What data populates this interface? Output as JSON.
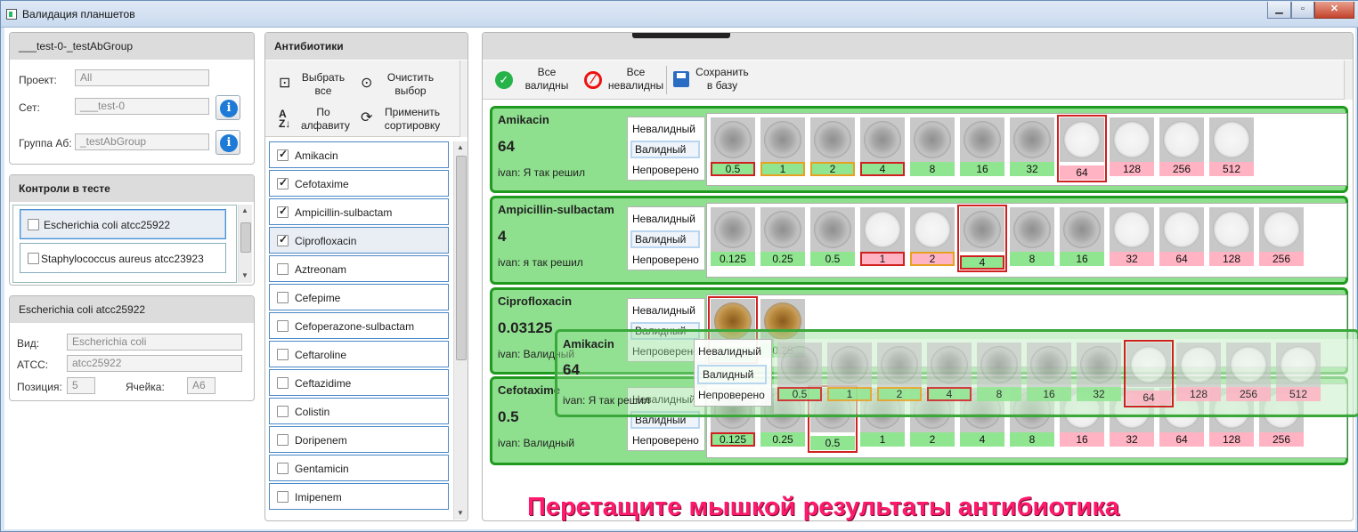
{
  "window": {
    "title": "Валидация планшетов",
    "min": "▁",
    "max": "▫",
    "close": "✕"
  },
  "group_panel": {
    "header": "___test-0-_testAbGroup",
    "project_label": "Проект:",
    "project_value": "All",
    "set_label": "Сет:",
    "set_value": "___test-0",
    "group_label": "Группа Аб:",
    "group_value": "_testAbGroup",
    "info_glyph": "i"
  },
  "controls_panel": {
    "header": "Контроли в тесте",
    "items": [
      "Escherichia coli atcc25922",
      "Staphylococcus aureus atcc23923"
    ]
  },
  "strain_panel": {
    "header": "Escherichia coli atcc25922",
    "species_label": "Вид:",
    "species_value": "Escherichia coli",
    "atcc_label": "ATCC:",
    "atcc_value": "atcc25922",
    "position_label": "Позиция:",
    "position_value": "5",
    "cell_label": "Ячейка:",
    "cell_value": "A6"
  },
  "antibiotics_panel": {
    "header": "Антибиотики",
    "select_all": "Выбрать\nвсе",
    "clear_selection": "Очистить\nвыбор",
    "sort_alpha": "По\nалфавиту",
    "apply_sort": "Применить\nсортировку",
    "items": [
      {
        "name": "Amikacin",
        "checked": true
      },
      {
        "name": "Cefotaxime",
        "checked": true
      },
      {
        "name": "Ampicillin-sulbactam",
        "checked": true
      },
      {
        "name": "Ciprofloxacin",
        "checked": true
      },
      {
        "name": "Aztreonam",
        "checked": false
      },
      {
        "name": "Cefepime",
        "checked": false
      },
      {
        "name": "Cefoperazone-sulbactam",
        "checked": false
      },
      {
        "name": "Ceftaroline",
        "checked": false
      },
      {
        "name": "Ceftazidime",
        "checked": false
      },
      {
        "name": "Colistin",
        "checked": false
      },
      {
        "name": "Doripenem",
        "checked": false
      },
      {
        "name": "Gentamicin",
        "checked": false
      },
      {
        "name": "Imipenem",
        "checked": false
      }
    ]
  },
  "toolbar": {
    "all_valid": "Все\nвалидны",
    "all_invalid": "Все\nневалидны",
    "save": "Сохранить\nв базу"
  },
  "validity_options": {
    "invalid": "Невалидный",
    "valid": "Валидный",
    "unverified": "Непроверено"
  },
  "cards": [
    {
      "name": "Amikacin",
      "mic": "64",
      "comment": "ivan:  Я так решил",
      "wells": [
        {
          "c": "0.5",
          "t": "gray",
          "lab": "green",
          "b": "r"
        },
        {
          "c": "1",
          "t": "gray",
          "lab": "green",
          "b": "o"
        },
        {
          "c": "2",
          "t": "gray",
          "lab": "green",
          "b": "o"
        },
        {
          "c": "4",
          "t": "gray",
          "lab": "green",
          "b": "r"
        },
        {
          "c": "8",
          "t": "gray",
          "lab": "green",
          "b": ""
        },
        {
          "c": "16",
          "t": "gray",
          "lab": "green",
          "b": ""
        },
        {
          "c": "32",
          "t": "gray",
          "lab": "green",
          "b": ""
        },
        {
          "c": "64",
          "t": "clear",
          "lab": "pink",
          "b": "",
          "big": true
        },
        {
          "c": "128",
          "t": "clear",
          "lab": "pink",
          "b": ""
        },
        {
          "c": "256",
          "t": "clear",
          "lab": "pink",
          "b": ""
        },
        {
          "c": "512",
          "t": "clear",
          "lab": "pink",
          "b": ""
        }
      ]
    },
    {
      "name": "Ampicillin-sulbactam",
      "mic": "4",
      "comment": "ivan:  я так решил",
      "wells": [
        {
          "c": "0.125",
          "t": "gray",
          "lab": "green",
          "b": ""
        },
        {
          "c": "0.25",
          "t": "gray",
          "lab": "green",
          "b": ""
        },
        {
          "c": "0.5",
          "t": "gray",
          "lab": "green",
          "b": ""
        },
        {
          "c": "1",
          "t": "clear",
          "lab": "pink",
          "b": "r"
        },
        {
          "c": "2",
          "t": "clear",
          "lab": "pink",
          "b": "o"
        },
        {
          "c": "4",
          "t": "gray",
          "lab": "green",
          "b": "r",
          "big": true
        },
        {
          "c": "8",
          "t": "gray",
          "lab": "green",
          "b": ""
        },
        {
          "c": "16",
          "t": "gray",
          "lab": "green",
          "b": ""
        },
        {
          "c": "32",
          "t": "clear",
          "lab": "pink",
          "b": ""
        },
        {
          "c": "64",
          "t": "clear",
          "lab": "pink",
          "b": ""
        },
        {
          "c": "128",
          "t": "clear",
          "lab": "pink",
          "b": ""
        },
        {
          "c": "256",
          "t": "clear",
          "lab": "pink",
          "b": ""
        }
      ]
    },
    {
      "name": "Ciprofloxacin",
      "mic": "0.03125",
      "comment": "ivan:  Валидный",
      "wells": [
        {
          "c": "0.03125",
          "t": "brown",
          "lab": "green",
          "b": "",
          "big": true
        },
        {
          "c": "0.25",
          "t": "brown",
          "lab": "green",
          "b": ""
        }
      ]
    },
    {
      "name": "Cefotaxime",
      "mic": "0.5",
      "comment": "ivan:  Валидный",
      "wells": [
        {
          "c": "0.125",
          "t": "gray",
          "lab": "green",
          "b": "r"
        },
        {
          "c": "0.25",
          "t": "gray",
          "lab": "green",
          "b": ""
        },
        {
          "c": "0.5",
          "t": "gray",
          "lab": "green",
          "b": "",
          "big": true
        },
        {
          "c": "1",
          "t": "gray",
          "lab": "green",
          "b": ""
        },
        {
          "c": "2",
          "t": "gray",
          "lab": "green",
          "b": ""
        },
        {
          "c": "4",
          "t": "gray",
          "lab": "green",
          "b": ""
        },
        {
          "c": "8",
          "t": "gray",
          "lab": "green",
          "b": ""
        },
        {
          "c": "16",
          "t": "clear",
          "lab": "pink",
          "b": ""
        },
        {
          "c": "32",
          "t": "clear",
          "lab": "pink",
          "b": ""
        },
        {
          "c": "64",
          "t": "clear",
          "lab": "pink",
          "b": ""
        },
        {
          "c": "128",
          "t": "clear",
          "lab": "pink",
          "b": ""
        },
        {
          "c": "256",
          "t": "clear",
          "lab": "pink",
          "b": ""
        }
      ]
    }
  ],
  "drag_ghost": {
    "name": "Amikacin",
    "mic": "64",
    "comment": "ivan:  Я так решил"
  },
  "instruction": "Перетащите мышкой результаты антибиотика"
}
